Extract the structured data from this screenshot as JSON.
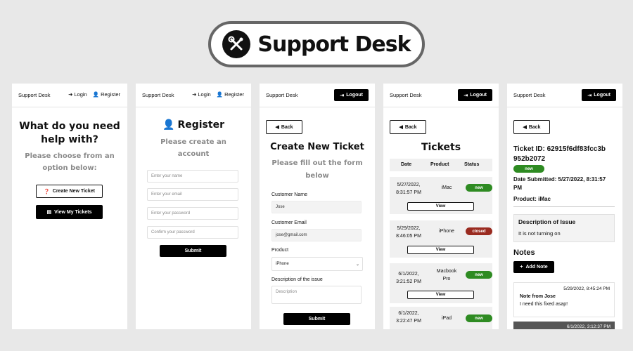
{
  "banner": {
    "title": "Support Desk",
    "icon": "wrench-screwdriver-icon"
  },
  "common": {
    "brand": "Support Desk",
    "login": "Login",
    "register": "Register",
    "logout": "Logout",
    "back": "Back"
  },
  "home": {
    "heading": "What do you need help with?",
    "subheading": "Please choose from an option below:",
    "create_btn": "Create New Ticket",
    "view_btn": "View My Tickets"
  },
  "register": {
    "heading": "Register",
    "subheading": "Please create an account",
    "name_placeholder": "Enter your name",
    "email_placeholder": "Enter your email",
    "password_placeholder": "Enter your password",
    "confirm_placeholder": "Confirm your password",
    "submit": "Submit"
  },
  "new_ticket": {
    "heading": "Create New Ticket",
    "subheading": "Please fill out the form below",
    "name_label": "Customer Name",
    "name_value": "Jose",
    "email_label": "Customer Email",
    "email_value": "jose@gmail.com",
    "product_label": "Product",
    "product_value": "iPhone",
    "desc_label": "Description of the issue",
    "desc_placeholder": "Description",
    "submit": "Submit"
  },
  "tickets": {
    "heading": "Tickets",
    "columns": [
      "Date",
      "Product",
      "Status"
    ],
    "view": "View",
    "rows": [
      {
        "date1": "5/27/2022,",
        "date2": "8:31:57 PM",
        "product1": "iMac",
        "product2": "",
        "status": "new"
      },
      {
        "date1": "5/29/2022,",
        "date2": "8:46:05 PM",
        "product1": "iPhone",
        "product2": "",
        "status": "closed"
      },
      {
        "date1": "6/1/2022,",
        "date2": "3:21:52 PM",
        "product1": "Macbook",
        "product2": "Pro",
        "status": "new"
      },
      {
        "date1": "6/1/2022,",
        "date2": "3:22:47 PM",
        "product1": "iPad",
        "product2": "",
        "status": "new"
      }
    ]
  },
  "ticket_detail": {
    "id_line1": "Ticket ID: 62915f6df83fcc3b",
    "id_line2": "952b2072",
    "status": "new",
    "date_line1": "Date Submitted: 5/27/2022, 8:31:57",
    "date_line2": "PM",
    "product": "Product: iMac",
    "desc_title": "Description of Issue",
    "desc_text": "It is not turning on",
    "notes_heading": "Notes",
    "add_note": "Add Note",
    "note_time": "5/29/2022, 8:45:24 PM",
    "note_author": "Note from Jose",
    "note_text": "I need this fixed asap!",
    "note2_time": "6/1/2022, 3:12:37 PM"
  }
}
